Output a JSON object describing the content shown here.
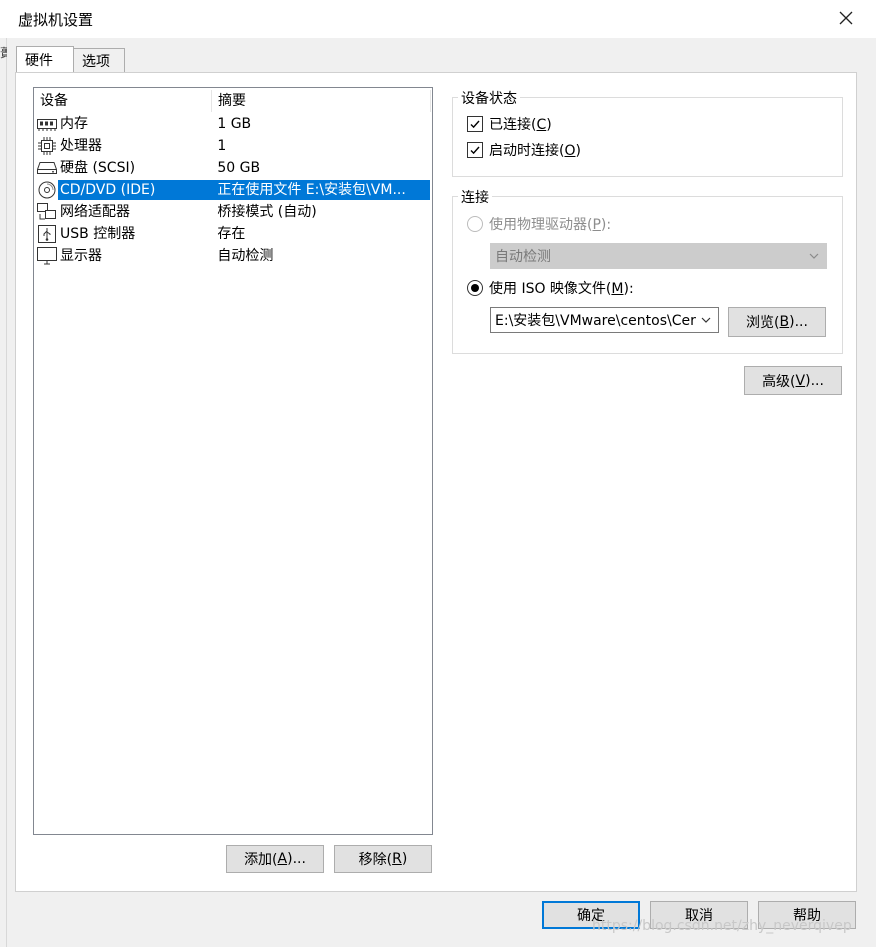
{
  "window": {
    "title": "虚拟机设置"
  },
  "left_strip": {
    "mark": "蕢"
  },
  "tabs": [
    {
      "label": "硬件",
      "active": true
    },
    {
      "label": "选项",
      "active": false
    }
  ],
  "device_list": {
    "columns": {
      "device": "设备",
      "summary": "摘要"
    },
    "rows": [
      {
        "icon": "memory-icon",
        "name": "内存",
        "summary": "1 GB",
        "selected": false
      },
      {
        "icon": "processor-icon",
        "name": "处理器",
        "summary": "1",
        "selected": false
      },
      {
        "icon": "hard-disk-icon",
        "name": "硬盘 (SCSI)",
        "summary": "50 GB",
        "selected": false
      },
      {
        "icon": "cd-dvd-icon",
        "name": "CD/DVD (IDE)",
        "summary": "正在使用文件 E:\\安装包\\VM...",
        "selected": true
      },
      {
        "icon": "network-adapter-icon",
        "name": "网络适配器",
        "summary": "桥接模式 (自动)",
        "selected": false
      },
      {
        "icon": "usb-icon",
        "name": "USB 控制器",
        "summary": "存在",
        "selected": false
      },
      {
        "icon": "display-icon",
        "name": "显示器",
        "summary": "自动检测",
        "selected": false
      }
    ],
    "add_button": {
      "text": "添加(",
      "key": "A",
      "tail": ")..."
    },
    "remove_button": {
      "text": "移除(",
      "key": "R",
      "tail": ")"
    }
  },
  "device_status": {
    "title": "设备状态",
    "connected": {
      "text": "已连接(",
      "key": "C",
      "tail": ")",
      "checked": true
    },
    "connect_at_power_on": {
      "text": "启动时连接(",
      "key": "O",
      "tail": ")",
      "checked": true
    }
  },
  "connection": {
    "title": "连接",
    "physical_drive": {
      "text": "使用物理驱动器(",
      "key": "P",
      "tail": "):",
      "selected": false,
      "enabled": false
    },
    "physical_drive_select": {
      "value": "自动检测"
    },
    "iso_image": {
      "text": "使用 ISO 映像文件(",
      "key": "M",
      "tail": "):",
      "selected": true
    },
    "iso_path_select": {
      "value": "E:\\安装包\\VMware\\centos\\Cer"
    },
    "browse_button": {
      "text": "浏览(",
      "key": "B",
      "tail": ")..."
    }
  },
  "advanced_button": {
    "text": "高级(",
    "key": "V",
    "tail": ")..."
  },
  "footer": {
    "ok": "确定",
    "cancel": "取消",
    "help": "帮助"
  },
  "watermark": "https://blog.csdn.net/zhy_neverqivep",
  "colors": {
    "selection": "#0078d7",
    "accent": "#0078d7"
  }
}
